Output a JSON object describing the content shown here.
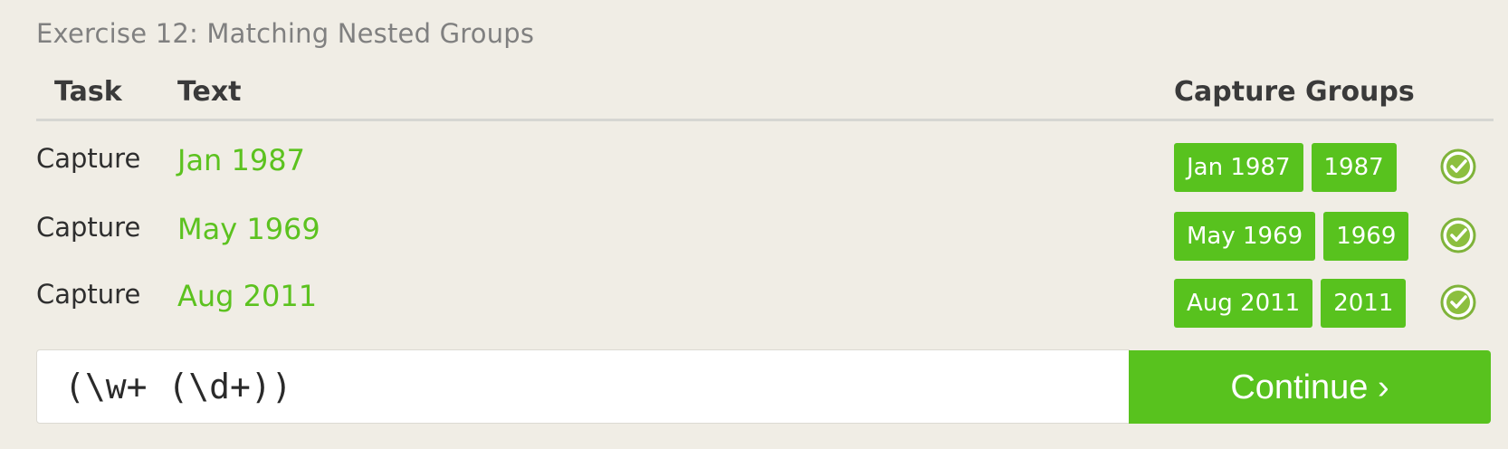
{
  "exercise": {
    "title": "Exercise 12: Matching Nested Groups"
  },
  "table": {
    "headers": {
      "task": "Task",
      "text": "Text",
      "capture_groups": "Capture Groups"
    },
    "rows": [
      {
        "task": "Capture",
        "text": "Jan 1987",
        "groups": [
          "Jan 1987",
          "1987"
        ],
        "status_icon": "check-circle-icon"
      },
      {
        "task": "Capture",
        "text": "May 1969",
        "groups": [
          "May 1969",
          "1969"
        ],
        "status_icon": "check-circle-icon"
      },
      {
        "task": "Capture",
        "text": "Aug 2011",
        "groups": [
          "Aug 2011",
          "2011"
        ],
        "status_icon": "check-circle-icon"
      }
    ]
  },
  "answer": {
    "value": "(\\w+ (\\d+))"
  },
  "continue_button": {
    "label": "Continue ›"
  },
  "colors": {
    "accent_green": "#58c21e",
    "text_green": "#5cc21f",
    "background": "#f0ede5"
  }
}
